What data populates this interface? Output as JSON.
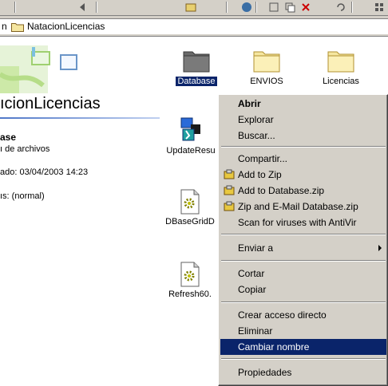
{
  "address": {
    "prefix": "n",
    "path": "NatacionLicencias"
  },
  "left_pane": {
    "folder_title": "ıcionLicencias",
    "selected_name": "ase",
    "selected_type": "ı de archivos",
    "selected_date": "ado: 03/04/2003 14:23",
    "selected_attrs": "ıs: (normal)"
  },
  "items": [
    {
      "name": "Database",
      "icon": "folder-dark-icon"
    },
    {
      "name": "ENVIOS",
      "icon": "folder-icon"
    },
    {
      "name": "Licencias",
      "icon": "folder-icon"
    },
    {
      "name": "UpdateResu",
      "icon": "program-icon"
    },
    {
      "name": "DBaseGridD",
      "icon": "settings-file-icon"
    },
    {
      "name": "Refresh60.",
      "icon": "settings-file-icon"
    }
  ],
  "context_menu": {
    "items": [
      {
        "label": "Abrir"
      },
      {
        "label": "Explorar"
      },
      {
        "label": "Buscar..."
      },
      {
        "label": "Compartir..."
      },
      {
        "label": "Add to Zip"
      },
      {
        "label": "Add to Database.zip"
      },
      {
        "label": "Zip and E-Mail Database.zip"
      },
      {
        "label": "Scan for viruses with AntiVir"
      },
      {
        "label": "Enviar a"
      },
      {
        "label": "Cortar"
      },
      {
        "label": "Copiar"
      },
      {
        "label": "Crear acceso directo"
      },
      {
        "label": "Eliminar"
      },
      {
        "label": "Cambiar nombre"
      },
      {
        "label": "Propiedades"
      }
    ]
  },
  "colors": {
    "selection": "#0a246a",
    "face": "#d4d0c8",
    "folder": "#f5e6a0"
  }
}
